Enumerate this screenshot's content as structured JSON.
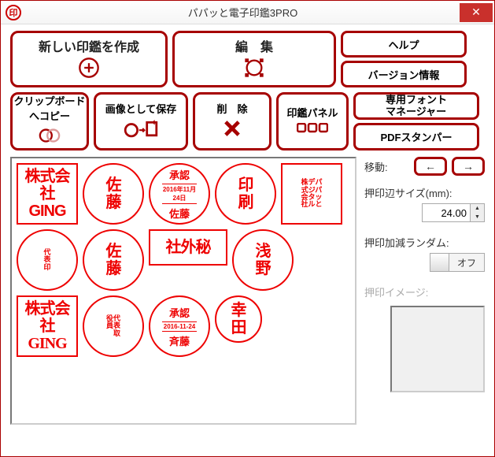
{
  "titlebar": {
    "icon_text": "印",
    "title": "パパッと電子印鑑3PRO",
    "close": "✕"
  },
  "toolbar": {
    "create": "新しい印鑑を作成",
    "edit": "編　集",
    "help": "ヘルプ",
    "version": "バージョン情報",
    "clipboard": "クリップボード\nへコピー",
    "save_image": "画像として保存",
    "delete": "削　除",
    "panel": "印鑑パネル",
    "font_mgr": "専用フォント\nマネージャー",
    "pdf": "PDFスタンパー"
  },
  "right": {
    "move": "移動:",
    "size_label": "押印辺サイズ(mm):",
    "size_value": "24.00",
    "random_label": "押印加減ランダム:",
    "random_state": "オフ",
    "preview_label": "押印イメージ:"
  },
  "stamps": [
    {
      "type": "square",
      "lines": "株式会社\nGING",
      "cls": "sq-text"
    },
    {
      "type": "round",
      "lines": "佐\n藤",
      "cls": "sq-text"
    },
    {
      "type": "round-date",
      "top": "承認",
      "mid": "2016年11月24日",
      "bot": "佐藤"
    },
    {
      "type": "round",
      "lines": "印\n刷",
      "cls": "sq-text"
    },
    {
      "type": "square",
      "lines": "株デパ\n式ジパ\n会タッ\n社ルと",
      "cls": "tiny"
    },
    {
      "type": "round",
      "lines": "代\n表\n印",
      "cls": "tiny wt"
    },
    {
      "type": "round",
      "lines": "佐\n藤",
      "cls": "sq-text outline"
    },
    {
      "type": "square",
      "lines": "社外秘",
      "cls": "sq-text",
      "wide": true
    },
    {
      "type": "round",
      "lines": "浅\n野",
      "cls": "sq-text"
    },
    {
      "type": "square",
      "lines": "株式会社\nGING",
      "cls": "sq-text outline"
    },
    {
      "type": "round",
      "lines": "役代\n員表\n　取",
      "cls": "tiny"
    },
    {
      "type": "round-date",
      "top": "承認",
      "mid": "2016-11-24",
      "bot": "斉藤"
    },
    {
      "type": "round",
      "lines": "幸\n田",
      "cls": "small sq-text"
    }
  ]
}
